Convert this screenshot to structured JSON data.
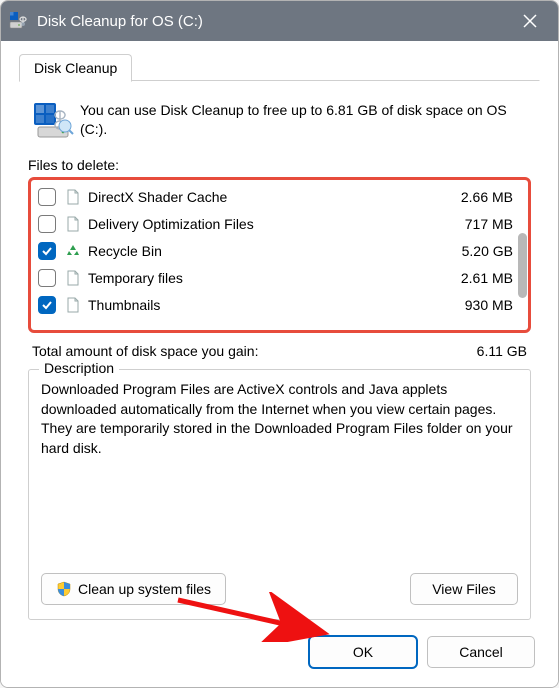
{
  "window": {
    "title": "Disk Cleanup for OS (C:)"
  },
  "tab": {
    "label": "Disk Cleanup"
  },
  "intro": "You can use Disk Cleanup to free up to 6.81 GB of disk space on OS (C:).",
  "files_label": "Files to delete:",
  "files": [
    {
      "name": "DirectX Shader Cache",
      "size": "2.66 MB",
      "checked": false,
      "icon": "file"
    },
    {
      "name": "Delivery Optimization Files",
      "size": "717 MB",
      "checked": false,
      "icon": "file"
    },
    {
      "name": "Recycle Bin",
      "size": "5.20 GB",
      "checked": true,
      "icon": "recycle"
    },
    {
      "name": "Temporary files",
      "size": "2.61 MB",
      "checked": false,
      "icon": "file"
    },
    {
      "name": "Thumbnails",
      "size": "930 MB",
      "checked": true,
      "icon": "file"
    }
  ],
  "total": {
    "label": "Total amount of disk space you gain:",
    "value": "6.11 GB"
  },
  "description": {
    "heading": "Description",
    "text": "Downloaded Program Files are ActiveX controls and Java applets downloaded automatically from the Internet when you view certain pages. They are temporarily stored in the Downloaded Program Files folder on your hard disk."
  },
  "buttons": {
    "clean_system": "Clean up system files",
    "view_files": "View Files",
    "ok": "OK",
    "cancel": "Cancel"
  }
}
